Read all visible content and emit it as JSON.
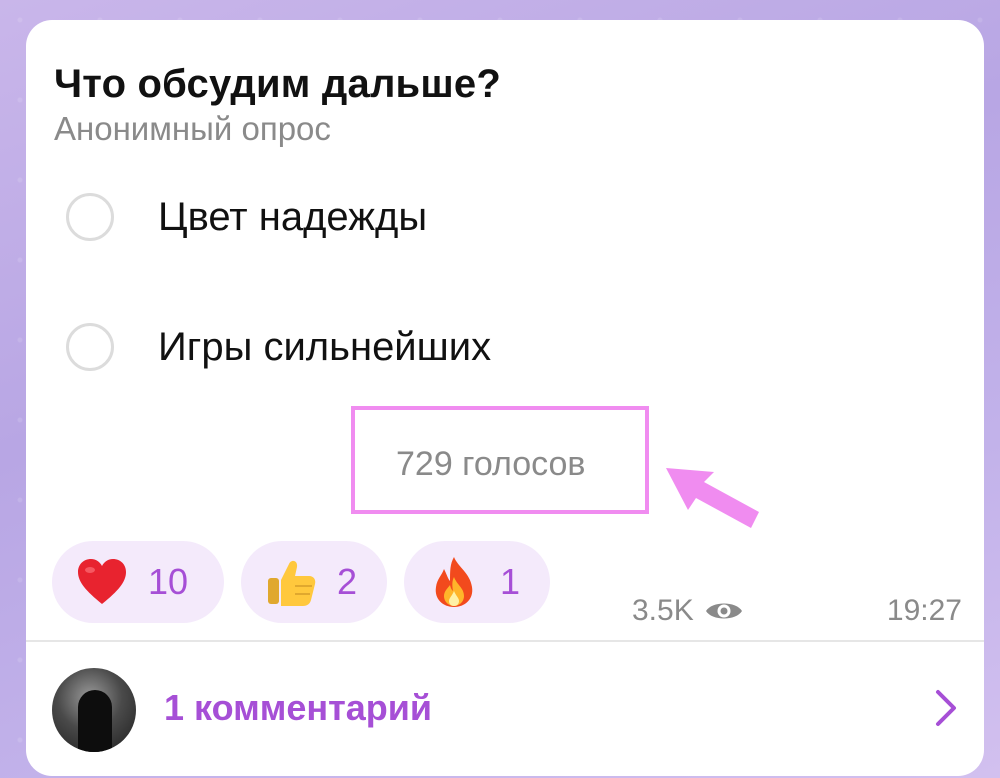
{
  "poll": {
    "question": "Что обсудим дальше?",
    "type_label": "Анонимный опрос",
    "options": [
      {
        "label": "Цвет надежды"
      },
      {
        "label": "Игры сильнейших"
      }
    ],
    "votes_label": "729 голосов"
  },
  "reactions": [
    {
      "emoji": "heart-icon",
      "count": "10"
    },
    {
      "emoji": "thumbs-up-icon",
      "count": "2"
    },
    {
      "emoji": "fire-icon",
      "count": "1"
    }
  ],
  "meta": {
    "views": "3.5K",
    "time": "19:27"
  },
  "comments": {
    "label": "1 комментарий"
  },
  "colors": {
    "accent": "#a64fd6",
    "highlight": "#f08cf0",
    "reaction_bg": "#f4eafb",
    "muted_text": "#8a8a8a"
  }
}
